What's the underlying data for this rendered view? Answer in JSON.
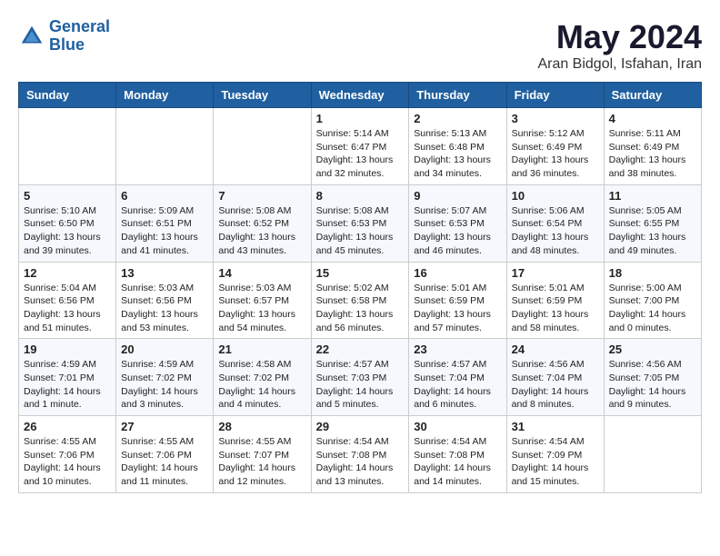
{
  "header": {
    "logo_line1": "General",
    "logo_line2": "Blue",
    "month": "May 2024",
    "location": "Aran Bidgol, Isfahan, Iran"
  },
  "weekdays": [
    "Sunday",
    "Monday",
    "Tuesday",
    "Wednesday",
    "Thursday",
    "Friday",
    "Saturday"
  ],
  "weeks": [
    [
      {
        "day": "",
        "info": ""
      },
      {
        "day": "",
        "info": ""
      },
      {
        "day": "",
        "info": ""
      },
      {
        "day": "1",
        "info": "Sunrise: 5:14 AM\nSunset: 6:47 PM\nDaylight: 13 hours and 32 minutes."
      },
      {
        "day": "2",
        "info": "Sunrise: 5:13 AM\nSunset: 6:48 PM\nDaylight: 13 hours and 34 minutes."
      },
      {
        "day": "3",
        "info": "Sunrise: 5:12 AM\nSunset: 6:49 PM\nDaylight: 13 hours and 36 minutes."
      },
      {
        "day": "4",
        "info": "Sunrise: 5:11 AM\nSunset: 6:49 PM\nDaylight: 13 hours and 38 minutes."
      }
    ],
    [
      {
        "day": "5",
        "info": "Sunrise: 5:10 AM\nSunset: 6:50 PM\nDaylight: 13 hours and 39 minutes."
      },
      {
        "day": "6",
        "info": "Sunrise: 5:09 AM\nSunset: 6:51 PM\nDaylight: 13 hours and 41 minutes."
      },
      {
        "day": "7",
        "info": "Sunrise: 5:08 AM\nSunset: 6:52 PM\nDaylight: 13 hours and 43 minutes."
      },
      {
        "day": "8",
        "info": "Sunrise: 5:08 AM\nSunset: 6:53 PM\nDaylight: 13 hours and 45 minutes."
      },
      {
        "day": "9",
        "info": "Sunrise: 5:07 AM\nSunset: 6:53 PM\nDaylight: 13 hours and 46 minutes."
      },
      {
        "day": "10",
        "info": "Sunrise: 5:06 AM\nSunset: 6:54 PM\nDaylight: 13 hours and 48 minutes."
      },
      {
        "day": "11",
        "info": "Sunrise: 5:05 AM\nSunset: 6:55 PM\nDaylight: 13 hours and 49 minutes."
      }
    ],
    [
      {
        "day": "12",
        "info": "Sunrise: 5:04 AM\nSunset: 6:56 PM\nDaylight: 13 hours and 51 minutes."
      },
      {
        "day": "13",
        "info": "Sunrise: 5:03 AM\nSunset: 6:56 PM\nDaylight: 13 hours and 53 minutes."
      },
      {
        "day": "14",
        "info": "Sunrise: 5:03 AM\nSunset: 6:57 PM\nDaylight: 13 hours and 54 minutes."
      },
      {
        "day": "15",
        "info": "Sunrise: 5:02 AM\nSunset: 6:58 PM\nDaylight: 13 hours and 56 minutes."
      },
      {
        "day": "16",
        "info": "Sunrise: 5:01 AM\nSunset: 6:59 PM\nDaylight: 13 hours and 57 minutes."
      },
      {
        "day": "17",
        "info": "Sunrise: 5:01 AM\nSunset: 6:59 PM\nDaylight: 13 hours and 58 minutes."
      },
      {
        "day": "18",
        "info": "Sunrise: 5:00 AM\nSunset: 7:00 PM\nDaylight: 14 hours and 0 minutes."
      }
    ],
    [
      {
        "day": "19",
        "info": "Sunrise: 4:59 AM\nSunset: 7:01 PM\nDaylight: 14 hours and 1 minute."
      },
      {
        "day": "20",
        "info": "Sunrise: 4:59 AM\nSunset: 7:02 PM\nDaylight: 14 hours and 3 minutes."
      },
      {
        "day": "21",
        "info": "Sunrise: 4:58 AM\nSunset: 7:02 PM\nDaylight: 14 hours and 4 minutes."
      },
      {
        "day": "22",
        "info": "Sunrise: 4:57 AM\nSunset: 7:03 PM\nDaylight: 14 hours and 5 minutes."
      },
      {
        "day": "23",
        "info": "Sunrise: 4:57 AM\nSunset: 7:04 PM\nDaylight: 14 hours and 6 minutes."
      },
      {
        "day": "24",
        "info": "Sunrise: 4:56 AM\nSunset: 7:04 PM\nDaylight: 14 hours and 8 minutes."
      },
      {
        "day": "25",
        "info": "Sunrise: 4:56 AM\nSunset: 7:05 PM\nDaylight: 14 hours and 9 minutes."
      }
    ],
    [
      {
        "day": "26",
        "info": "Sunrise: 4:55 AM\nSunset: 7:06 PM\nDaylight: 14 hours and 10 minutes."
      },
      {
        "day": "27",
        "info": "Sunrise: 4:55 AM\nSunset: 7:06 PM\nDaylight: 14 hours and 11 minutes."
      },
      {
        "day": "28",
        "info": "Sunrise: 4:55 AM\nSunset: 7:07 PM\nDaylight: 14 hours and 12 minutes."
      },
      {
        "day": "29",
        "info": "Sunrise: 4:54 AM\nSunset: 7:08 PM\nDaylight: 14 hours and 13 minutes."
      },
      {
        "day": "30",
        "info": "Sunrise: 4:54 AM\nSunset: 7:08 PM\nDaylight: 14 hours and 14 minutes."
      },
      {
        "day": "31",
        "info": "Sunrise: 4:54 AM\nSunset: 7:09 PM\nDaylight: 14 hours and 15 minutes."
      },
      {
        "day": "",
        "info": ""
      }
    ]
  ]
}
